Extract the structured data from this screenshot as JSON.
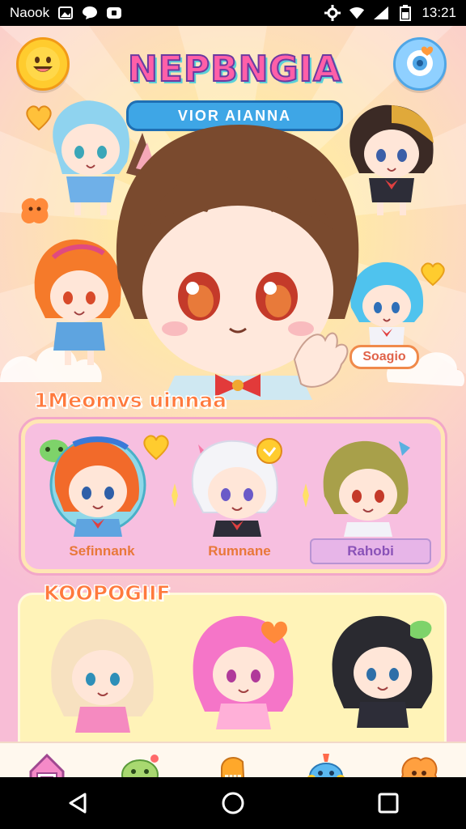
{
  "status_bar": {
    "carrier": "Naook",
    "time": "13:21"
  },
  "header": {
    "app_title": "NEPBNGIA",
    "subtitle": "VIOR AIANNA",
    "emoji_icon": "smiley-face-icon",
    "chat_icon": "chat-bubble-icon"
  },
  "hero": {
    "badge_label": "Soagio"
  },
  "section1": {
    "title": "1Meomvs uinnaa",
    "cards": [
      {
        "label": "Sefinnank"
      },
      {
        "label": "Rumnane"
      },
      {
        "label": "Rahobi"
      }
    ]
  },
  "section2": {
    "title": "KOOPOGIIF"
  },
  "bottom_nav": {
    "items": [
      {
        "icon": "house-icon"
      },
      {
        "icon": "frog-mascot-icon"
      },
      {
        "icon": "piano-icon"
      },
      {
        "icon": "monster-icon"
      },
      {
        "icon": "cookie-mascot-icon"
      }
    ]
  },
  "colors": {
    "accent_pink": "#ff5fa8",
    "accent_orange": "#ff7a3d",
    "accent_blue": "#3ea6e6",
    "panel_pink": "#f7bfe0",
    "panel_yellow": "#fff3b8"
  }
}
